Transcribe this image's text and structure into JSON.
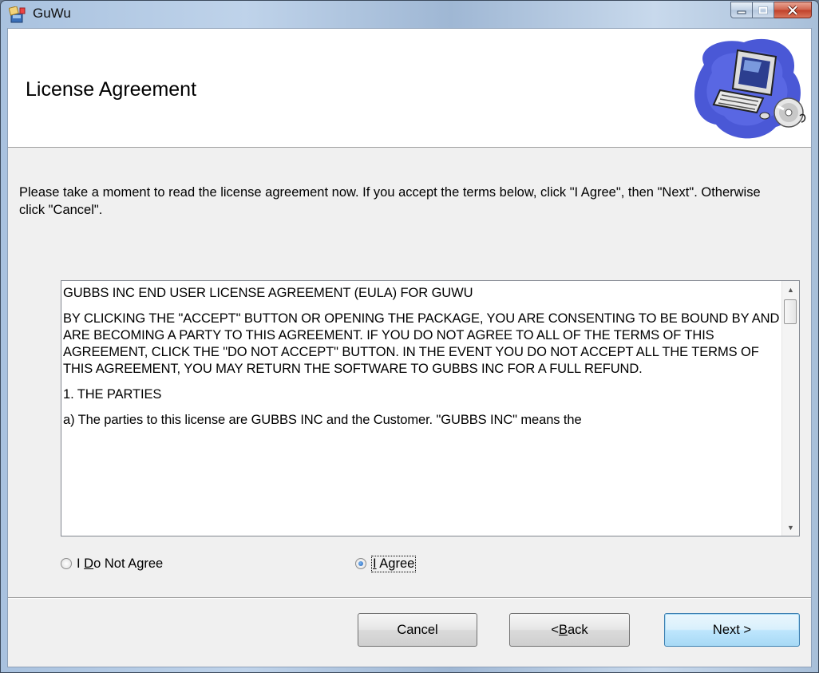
{
  "window": {
    "title": "GuWu",
    "icon": "installer-icon",
    "caption_buttons": [
      "minimize",
      "maximize",
      "close"
    ]
  },
  "banner": {
    "title": "License Agreement",
    "art": "computer-setup-illustration"
  },
  "instructions": "Please take a moment to read the license agreement now. If you accept the terms below, click \"I Agree\", then \"Next\". Otherwise click \"Cancel\".",
  "eula": {
    "paragraphs": [
      "GUBBS INC END USER LICENSE AGREEMENT (EULA) FOR GUWU",
      "BY CLICKING THE \"ACCEPT\" BUTTON OR OPENING THE PACKAGE, YOU ARE CONSENTING TO BE BOUND BY AND ARE BECOMING A PARTY TO THIS AGREEMENT.  IF YOU DO NOT AGREE TO ALL OF THE TERMS OF THIS AGREEMENT, CLICK THE \"DO NOT ACCEPT\" BUTTON.  IN THE EVENT YOU DO NOT ACCEPT ALL THE TERMS OF THIS AGREEMENT, YOU MAY RETURN THE SOFTWARE TO GUBBS INC FOR A FULL REFUND.",
      "1. THE PARTIES",
      "a) The parties to this license are GUBBS INC and the Customer.  \"GUBBS INC\" means the"
    ]
  },
  "options": {
    "disagree": {
      "pre": "I ",
      "mnemonic": "D",
      "post": "o Not Agree",
      "selected": false
    },
    "agree": {
      "mnemonic": "I",
      "post": " Agree",
      "selected": true
    }
  },
  "buttons": {
    "cancel": "Cancel",
    "back": {
      "pre": "< ",
      "mnemonic": "B",
      "post": "ack"
    },
    "next": "Next >"
  },
  "colors": {
    "default_button_border": "#3c7fb1",
    "radio_selected": "#1f5fb5"
  }
}
